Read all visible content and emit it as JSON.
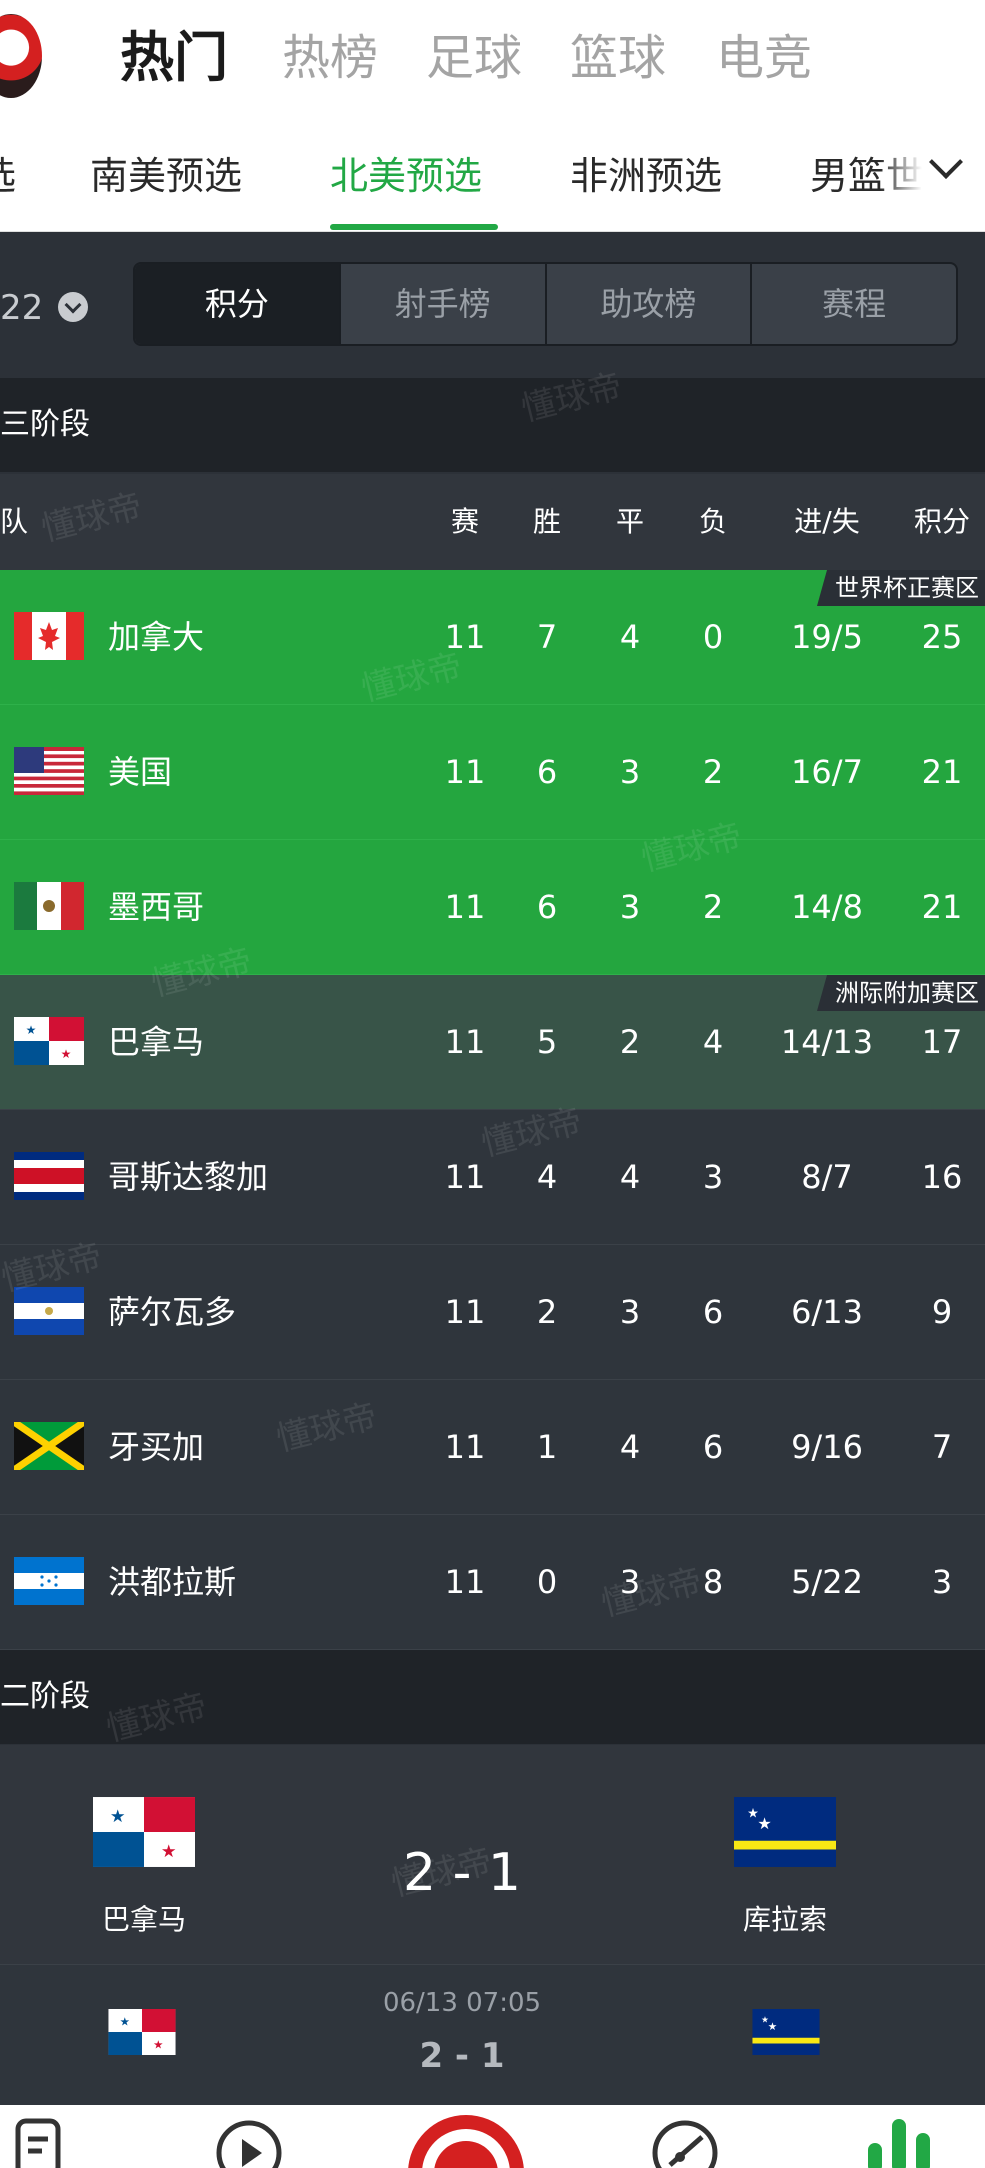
{
  "header": {
    "tabs": [
      {
        "label": "热门",
        "active": true
      },
      {
        "label": "热榜",
        "active": false
      },
      {
        "label": "足球",
        "active": false
      },
      {
        "label": "篮球",
        "active": false
      },
      {
        "label": "电竞",
        "active": false
      }
    ]
  },
  "subtabs": {
    "items": [
      {
        "label": "选"
      },
      {
        "label": "南美预选"
      },
      {
        "label": "北美预选",
        "active": true
      },
      {
        "label": "非洲预选"
      },
      {
        "label": "男篮世"
      }
    ]
  },
  "filter": {
    "season": "22",
    "segments": [
      {
        "label": "积分",
        "active": true
      },
      {
        "label": "射手榜"
      },
      {
        "label": "助攻榜"
      },
      {
        "label": "赛程"
      }
    ]
  },
  "stage3": {
    "title": "三阶段",
    "columns": {
      "team": "队",
      "played": "赛",
      "won": "胜",
      "drawn": "平",
      "lost": "负",
      "goals": "进/失",
      "points": "积分"
    },
    "zones": {
      "direct": "世界杯正赛区",
      "playoff": "洲际附加赛区"
    },
    "rows": [
      {
        "team": "加拿大",
        "flag": "canada-flag",
        "played": "11",
        "won": "7",
        "drawn": "4",
        "lost": "0",
        "goals": "19/5",
        "points": "25"
      },
      {
        "team": "美国",
        "flag": "usa-flag",
        "played": "11",
        "won": "6",
        "drawn": "3",
        "lost": "2",
        "goals": "16/7",
        "points": "21"
      },
      {
        "team": "墨西哥",
        "flag": "mexico-flag",
        "played": "11",
        "won": "6",
        "drawn": "3",
        "lost": "2",
        "goals": "14/8",
        "points": "21"
      },
      {
        "team": "巴拿马",
        "flag": "panama-flag",
        "played": "11",
        "won": "5",
        "drawn": "2",
        "lost": "4",
        "goals": "14/13",
        "points": "17"
      },
      {
        "team": "哥斯达黎加",
        "flag": "costa-rica-flag",
        "played": "11",
        "won": "4",
        "drawn": "4",
        "lost": "3",
        "goals": "8/7",
        "points": "16"
      },
      {
        "team": "萨尔瓦多",
        "flag": "el-salvador-flag",
        "played": "11",
        "won": "2",
        "drawn": "3",
        "lost": "6",
        "goals": "6/13",
        "points": "9"
      },
      {
        "team": "牙买加",
        "flag": "jamaica-flag",
        "played": "11",
        "won": "1",
        "drawn": "4",
        "lost": "6",
        "goals": "9/16",
        "points": "7"
      },
      {
        "team": "洪都拉斯",
        "flag": "honduras-flag",
        "played": "11",
        "won": "0",
        "drawn": "3",
        "lost": "8",
        "goals": "5/22",
        "points": "3"
      }
    ]
  },
  "stage2": {
    "title": "二阶段",
    "match": {
      "home": "巴拿马",
      "away": "库拉索",
      "score": "2 - 1"
    },
    "match2": {
      "time": "06/13  07:05",
      "score": "2 - 1"
    }
  },
  "watermark": "懂球帝",
  "colors": {
    "accent": "#22a845",
    "qualify_green": "#24a63f",
    "playoff_green": "#385448",
    "background": "#2c3138"
  }
}
